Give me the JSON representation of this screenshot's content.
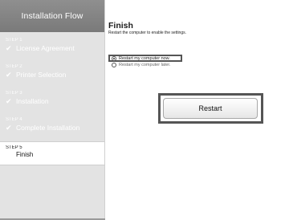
{
  "sidebar": {
    "header": "Installation Flow",
    "steps": [
      {
        "number": "STEP 1",
        "label": "License Agreement",
        "check": "✔"
      },
      {
        "number": "STEP 2",
        "label": "Printer Selection",
        "check": "✔"
      },
      {
        "number": "STEP 3",
        "label": "Installation",
        "check": "✔"
      },
      {
        "number": "STEP 4",
        "label": "Complete Installation",
        "check": "✔"
      },
      {
        "number": "STEP 5",
        "label": "Finish"
      }
    ]
  },
  "main": {
    "title": "Finish",
    "subtitle": "Restart the computer to enable the settings.",
    "options": [
      {
        "label": "Restart my computer now.",
        "selected": true
      },
      {
        "label": "Restart my computer later.",
        "selected": false
      }
    ],
    "restart_label": "Restart"
  },
  "colors": {
    "sidebar_bg": "#e3e3e3",
    "header_bg": "#7f7f7f",
    "highlight_border": "#555555"
  }
}
